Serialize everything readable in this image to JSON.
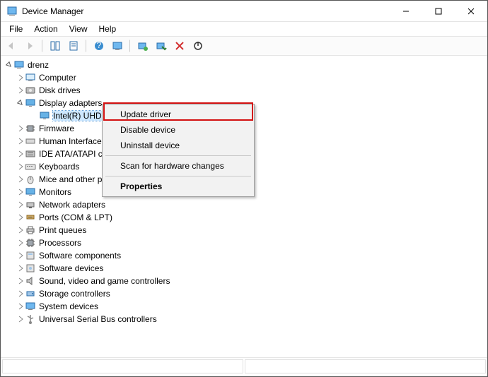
{
  "window": {
    "title": "Device Manager"
  },
  "menubar": {
    "file": "File",
    "action": "Action",
    "view": "View",
    "help": "Help"
  },
  "tree": {
    "root": "drenz",
    "computer": "Computer",
    "disk_drives": "Disk drives",
    "display_adapters": "Display adapters",
    "intel_uhd": "Intel(R) UHD",
    "firmware": "Firmware",
    "human_interface": "Human Interface",
    "ide_ata": "IDE ATA/ATAPI co",
    "keyboards": "Keyboards",
    "mice": "Mice and other p",
    "monitors": "Monitors",
    "network_adapters": "Network adapters",
    "ports": "Ports (COM & LPT)",
    "print_queues": "Print queues",
    "processors": "Processors",
    "sw_components": "Software components",
    "sw_devices": "Software devices",
    "sound": "Sound, video and game controllers",
    "storage": "Storage controllers",
    "system": "System devices",
    "usb": "Universal Serial Bus controllers"
  },
  "context_menu": {
    "update": "Update driver",
    "disable": "Disable device",
    "uninstall": "Uninstall device",
    "scan": "Scan for hardware changes",
    "properties": "Properties"
  }
}
